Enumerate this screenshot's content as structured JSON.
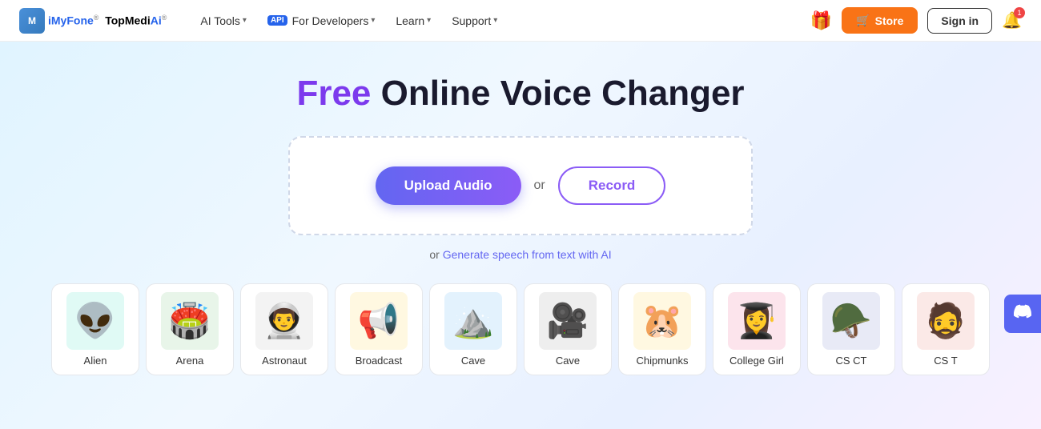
{
  "nav": {
    "logo_m": "M",
    "logo_imyfone": "iMyFone",
    "logo_reg": "®",
    "logo_top": "TopMedi",
    "logo_ai": "Ai",
    "logo_ai_reg": "®",
    "ai_tools": "AI Tools",
    "api_badge": "API",
    "for_developers": "For Developers",
    "learn": "Learn",
    "support": "Support",
    "store": "Store",
    "signin": "Sign in",
    "bell_count": "1"
  },
  "hero": {
    "title_free": "Free",
    "title_rest": " Online Voice Changer"
  },
  "upload": {
    "upload_btn": "Upload Audio",
    "or": "or",
    "record_btn": "Record"
  },
  "generate": {
    "prefix": "or ",
    "link": "Generate speech from text with AI"
  },
  "voice_cards": [
    {
      "id": "alien",
      "label": "Alien",
      "emoji": "👽",
      "bg": "#e0faf5"
    },
    {
      "id": "arena",
      "label": "Arena",
      "emoji": "🏟️",
      "bg": "#e8f5e9"
    },
    {
      "id": "astronaut",
      "label": "Astronaut",
      "emoji": "👨‍🚀",
      "bg": "#f3f3f3"
    },
    {
      "id": "broadcast",
      "label": "Broadcast",
      "emoji": "📢",
      "bg": "#fff8e1"
    },
    {
      "id": "cave1",
      "label": "Cave",
      "emoji": "⛰️",
      "bg": "#e3f2fd"
    },
    {
      "id": "cave2",
      "label": "Cave",
      "emoji": "🎥",
      "bg": "#eeeeee"
    },
    {
      "id": "chipmunks",
      "label": "Chipmunks",
      "emoji": "🐹",
      "bg": "#fff8e1"
    },
    {
      "id": "college_girl",
      "label": "College Girl",
      "emoji": "👩‍🎓",
      "bg": "#fce4ec"
    },
    {
      "id": "cs_ct",
      "label": "CS CT",
      "emoji": "🪖",
      "bg": "#e8eaf6"
    },
    {
      "id": "cs_t",
      "label": "CS T",
      "emoji": "🧔",
      "bg": "#fbe9e7"
    }
  ],
  "discord": "💬"
}
